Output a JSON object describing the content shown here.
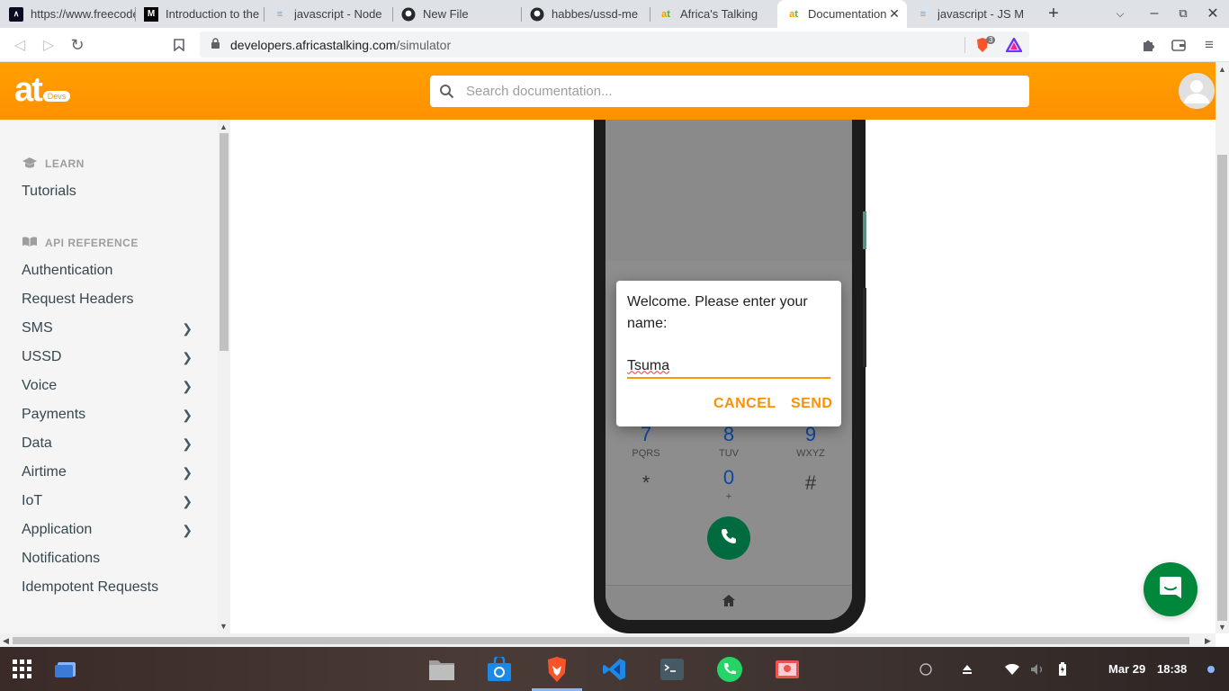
{
  "tabs": [
    {
      "label": "https://www.freecodecamp.org",
      "icon": "freecodecamp-icon"
    },
    {
      "label": "Introduction to the",
      "icon": "medium-icon"
    },
    {
      "label": "javascript - Node",
      "icon": "stackoverflow-icon"
    },
    {
      "label": "New File",
      "icon": "github-icon"
    },
    {
      "label": "habbes/ussd-me",
      "icon": "github-icon"
    },
    {
      "label": "Africa's Talking",
      "icon": "africastalking-icon"
    },
    {
      "label": "Documentation",
      "icon": "africastalking-icon"
    },
    {
      "label": "javascript - JS M",
      "icon": "stackoverflow-icon"
    }
  ],
  "address": {
    "domain": "developers.africastalking.com",
    "path": "/simulator",
    "shield_count": "3"
  },
  "header": {
    "logo": "at",
    "logo_badge": "Devs",
    "search_placeholder": "Search documentation..."
  },
  "sidebar": {
    "learn_title": "LEARN",
    "learn_items": [
      {
        "label": "Tutorials"
      }
    ],
    "api_title": "API REFERENCE",
    "api_items": [
      {
        "label": "Authentication",
        "expandable": false
      },
      {
        "label": "Request Headers",
        "expandable": false
      },
      {
        "label": "SMS",
        "expandable": true
      },
      {
        "label": "USSD",
        "expandable": true
      },
      {
        "label": "Voice",
        "expandable": true
      },
      {
        "label": "Payments",
        "expandable": true
      },
      {
        "label": "Data",
        "expandable": true
      },
      {
        "label": "Airtime",
        "expandable": true
      },
      {
        "label": "IoT",
        "expandable": true
      },
      {
        "label": "Application",
        "expandable": true
      },
      {
        "label": "Notifications",
        "expandable": false
      },
      {
        "label": "Idempotent Requests",
        "expandable": false
      }
    ]
  },
  "dialer": {
    "keys": [
      {
        "num": "7",
        "letters": "PQRS"
      },
      {
        "num": "8",
        "letters": "TUV"
      },
      {
        "num": "9",
        "letters": "WXYZ"
      },
      {
        "num": "*",
        "letters": ""
      },
      {
        "num": "0",
        "letters": "+"
      },
      {
        "num": "#",
        "letters": ""
      }
    ]
  },
  "dialog": {
    "message": "Welcome. Please enter your name:",
    "input_value": "Tsuma",
    "cancel_label": "CANCEL",
    "send_label": "SEND"
  },
  "taskbar": {
    "date": "Mar 29",
    "time": "18:38"
  },
  "colors": {
    "accent": "#ff9800",
    "call": "#006b3f",
    "chat": "#00873c"
  }
}
